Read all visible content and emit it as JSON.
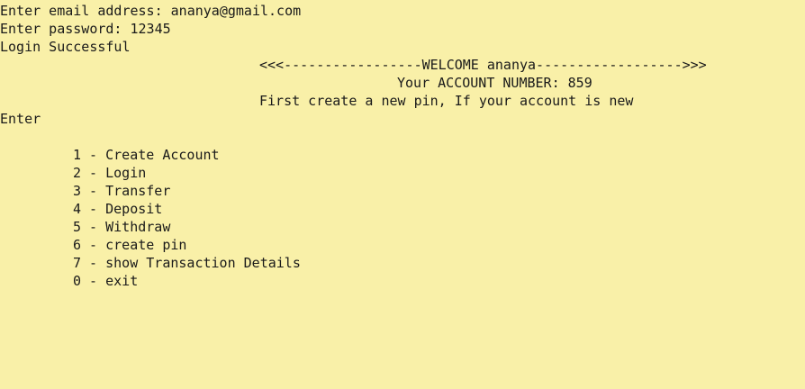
{
  "console": {
    "email_prompt": "Enter email address: ananya@gmail.com",
    "password_prompt": "Enter password: 12345",
    "login_status": "Login Successful",
    "welcome_banner": "<<<-----------------WELCOME ananya------------------>>>",
    "account_number": "Your ACCOUNT NUMBER: 859",
    "pin_hint": "First create a new pin, If your account is new",
    "enter_prompt": "Enter",
    "menu": [
      "1 - Create Account",
      "2 - Login",
      "3 - Transfer",
      "4 - Deposit",
      "5 - Withdraw",
      "6 - create pin",
      "7 - show Transaction Details",
      "0 - exit"
    ]
  }
}
